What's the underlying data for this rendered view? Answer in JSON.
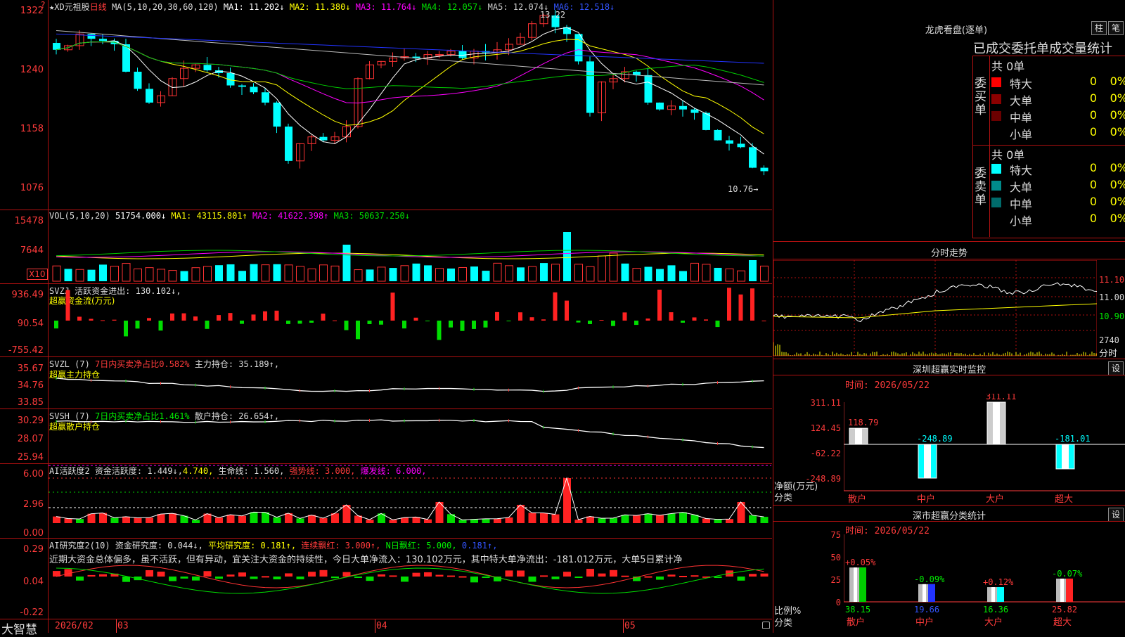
{
  "app": {
    "brand": "大智慧",
    "header_icon": "?"
  },
  "kline": {
    "title": "★XD元祖股",
    "period": "日线",
    "ma_def": "MA(5,10,20,30,60,120)",
    "ma1": "MA1: 11.202↓",
    "ma2": "MA2: 11.380↓",
    "ma3": "MA3: 11.764↓",
    "ma4": "MA4: 12.057↓",
    "ma5": "MA5: 12.074↓",
    "ma6": "MA6: 12.518↓",
    "high_mark": "13.22",
    "low_mark": "10.76→",
    "y_ticks": [
      "1322",
      "1240",
      "1158",
      "1076"
    ],
    "colors": {
      "ma1": "#ffffff",
      "ma2": "#ffff00",
      "ma3": "#ff00ff",
      "ma4": "#00cc00",
      "ma5": "#cccccc",
      "ma6": "#0000ff"
    }
  },
  "vol": {
    "title": "VOL(5,10,20)",
    "value": "51754.000↓",
    "ma1": "MA1: 43115.801↑",
    "ma2": "MA2: 41622.398↑",
    "ma3": "MA3: 50637.250↓",
    "y_ticks": [
      "15478",
      "7644"
    ],
    "unit": "X10"
  },
  "svzj": {
    "title": "SVZJ",
    "label": "活跃资金进出: 130.102↓,",
    "sub": "超赢资金流(万元)",
    "y_ticks": [
      "936.49",
      "90.54",
      "-755.42"
    ]
  },
  "svzl": {
    "title": "SVZL (7)",
    "label1": "7日内买卖净占比0.582%",
    "label2": "主力持仓: 35.189↑,",
    "sub": "超赢主力持仓",
    "y_ticks": [
      "35.67",
      "34.76",
      "33.85"
    ]
  },
  "svsh": {
    "title": "SVSH (7)",
    "label1": "7日内买卖净占比1.461%",
    "label2": "散户持仓: 26.654↑,",
    "sub": "超赢散户持仓",
    "y_ticks": [
      "30.29",
      "28.07",
      "25.94"
    ]
  },
  "ai1": {
    "title": "AI活跃度2",
    "label1": "资金活跃度: 1.449↓,",
    "label1b": "4.740,",
    "label2": "生命线: 1.560,",
    "label3": "强势线: 3.000,",
    "label4": "爆发线: 6.000,",
    "y_ticks": [
      "6.00",
      "2.96",
      "0.00"
    ]
  },
  "ai2": {
    "title": "AI研究度2(10)",
    "label1": "资金研究度: 0.044↓,",
    "label2": "平均研究度: 0.181↑,",
    "label3": "连续飘红: 3.000↑,",
    "label4": "N日飘红: 5.000,",
    "label5": "0.181↑,",
    "desc": "近期大资金总体偏多，虽不活跃，但有异动，宜关注大资金的持续性，今日大单净流入：130.102万元，其中特大单净流出：-181.012万元，大单5日累计净",
    "y_ticks": [
      "0.29",
      "0.04",
      "-0.22"
    ]
  },
  "xaxis": {
    "labels": [
      "2026/02",
      "03",
      "04",
      "05"
    ]
  },
  "dragon": {
    "title": "龙虎看盘(逐单)",
    "btn1": "柱",
    "btn2": "笔",
    "subtitle": "已成交委托单成交量统计",
    "buy_side": "委买单",
    "sell_side": "委卖单",
    "buy_total": "共 0单",
    "sell_total": "共 0单",
    "buy_rows": [
      {
        "label": "特大",
        "count": "0",
        "pct": "0%",
        "color": "#ff0000"
      },
      {
        "label": "大单",
        "count": "0",
        "pct": "0%",
        "color": "#8b0000"
      },
      {
        "label": "中单",
        "count": "0",
        "pct": "0%",
        "color": "#6b0000"
      },
      {
        "label": "小单",
        "count": "0",
        "pct": "0%",
        "color": "#000000"
      }
    ],
    "sell_rows": [
      {
        "label": "特大",
        "count": "0",
        "pct": "0%",
        "color": "#00ffff"
      },
      {
        "label": "大单",
        "count": "0",
        "pct": "0%",
        "color": "#008b8b"
      },
      {
        "label": "中单",
        "count": "0",
        "pct": "0%",
        "color": "#006b6b"
      },
      {
        "label": "小单",
        "count": "0",
        "pct": "0%",
        "color": "#000000"
      }
    ]
  },
  "intraday": {
    "title": "分时走势",
    "y_ticks": [
      "11.10",
      "11.00",
      "10.90"
    ],
    "vol_tick": "2740",
    "vol_label": "分时"
  },
  "sz_monitor": {
    "title": "深圳超赢实时监控",
    "btn": "设",
    "time": "时间: 2026/05/22",
    "y_ticks": [
      "311.11",
      "124.45",
      "-62.22",
      "-248.89"
    ],
    "ylabel": "净额(万元)",
    "xlabel": "分类",
    "categories": [
      "散户",
      "中户",
      "大户",
      "超大"
    ],
    "values_text": [
      "118.79",
      "-248.89",
      "311.11",
      "-181.01"
    ]
  },
  "sz_class": {
    "title": "深市超赢分类统计",
    "btn": "设",
    "time": "时间: 2026/05/22",
    "y_ticks": [
      "75",
      "50",
      "25",
      "0"
    ],
    "ylabel": "比例%",
    "xlabel": "分类",
    "categories": [
      "散户",
      "中户",
      "大户",
      "超大"
    ],
    "base_text": [
      "38.15",
      "19.66",
      "16.36",
      "25.82"
    ],
    "chg_text": [
      "+0.05%",
      "-0.09%",
      "+0.12%",
      "-0.07%"
    ]
  },
  "chart_data": [
    {
      "type": "bar",
      "title": "深圳超赢实时监控",
      "categories": [
        "散户",
        "中户",
        "大户",
        "超大"
      ],
      "values": [
        118.79,
        -248.89,
        311.11,
        -181.01
      ],
      "ylabel": "净额(万元)",
      "ylim": [
        -248.89,
        311.11
      ]
    },
    {
      "type": "bar",
      "title": "深市超赢分类统计",
      "categories": [
        "散户",
        "中户",
        "大户",
        "超大"
      ],
      "values": [
        38.15,
        19.66,
        16.36,
        25.82
      ],
      "ylabel": "比例%",
      "ylim": [
        0,
        75
      ]
    }
  ]
}
